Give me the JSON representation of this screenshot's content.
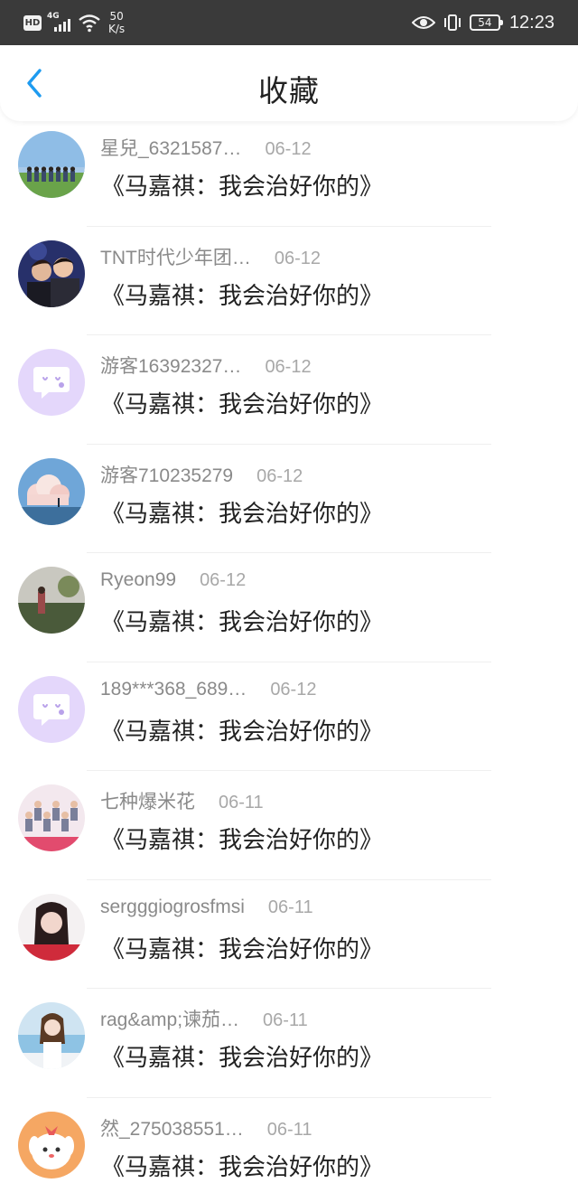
{
  "status_bar": {
    "hd_label": "HD",
    "network_label": "4G",
    "speed_value": "50",
    "speed_unit": "K/s",
    "battery": "54",
    "time": "12:23",
    "icons": [
      "hd-icon",
      "signal-icon",
      "wifi-icon",
      "eye-icon",
      "vibrate-icon",
      "battery-icon"
    ]
  },
  "header": {
    "title": "收藏",
    "back_icon": "chevron-left-icon",
    "accent_color": "#1e9bf0"
  },
  "items": [
    {
      "username": "星兒_6321587…",
      "date": "06-12",
      "title": "《马嘉祺：我会治好你的》",
      "avatar": "group-photo"
    },
    {
      "username": "TNT时代少年团…",
      "date": "06-12",
      "title": "《马嘉祺：我会治好你的》",
      "avatar": "duo-photo"
    },
    {
      "username": "游客16392327…",
      "date": "06-12",
      "title": "《马嘉祺：我会治好你的》",
      "avatar": "default-chat"
    },
    {
      "username": "游客710235279",
      "date": "06-12",
      "title": "《马嘉祺：我会治好你的》",
      "avatar": "cloud-sky"
    },
    {
      "username": "Ryeon99",
      "date": "06-12",
      "title": "《马嘉祺：我会治好你的》",
      "avatar": "landscape"
    },
    {
      "username": "189***368_689…",
      "date": "06-12",
      "title": "《马嘉祺：我会治好你的》",
      "avatar": "default-chat"
    },
    {
      "username": "七种爆米花",
      "date": "06-11",
      "title": "《马嘉祺：我会治好你的》",
      "avatar": "group-pink"
    },
    {
      "username": "sergggiogrosfmsi",
      "date": "06-11",
      "title": "《马嘉祺：我会治好你的》",
      "avatar": "girl-red"
    },
    {
      "username": "rag&amp;谏茄…",
      "date": "06-11",
      "title": "《马嘉祺：我会治好你的》",
      "avatar": "girl-sea"
    },
    {
      "username": "然_275038551…",
      "date": "06-11",
      "title": "《马嘉祺：我会治好你的》",
      "avatar": "cartoon-dog"
    }
  ]
}
